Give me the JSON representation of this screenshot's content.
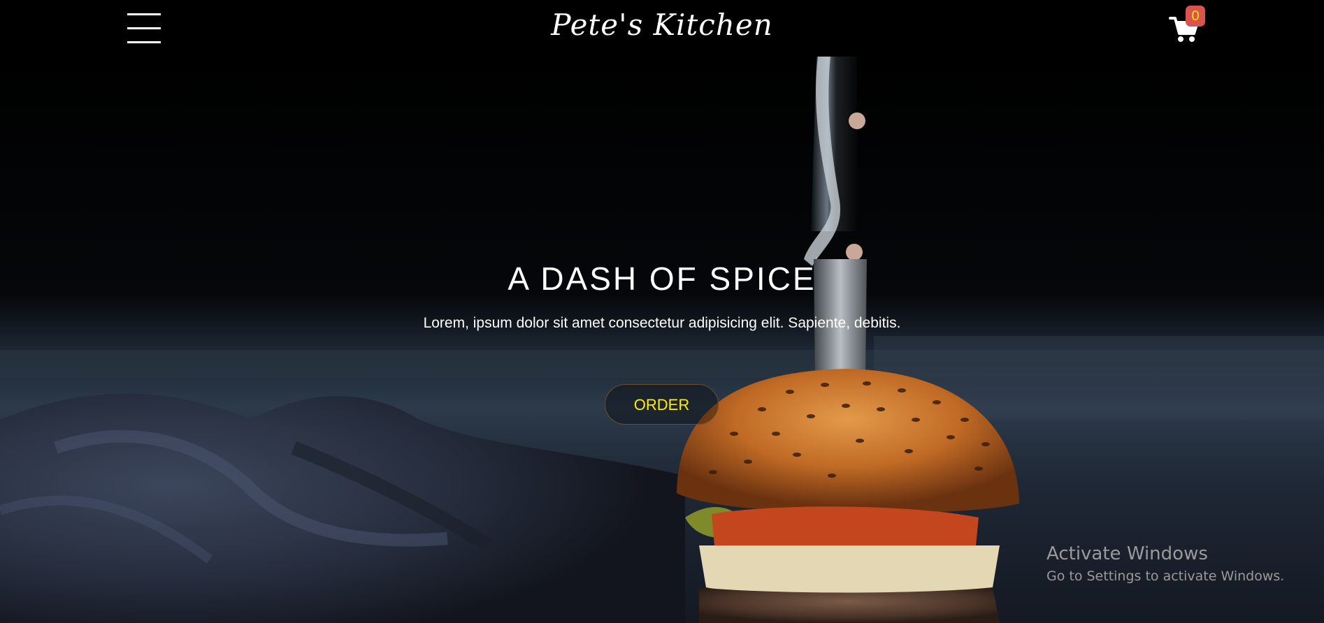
{
  "header": {
    "brand": "Pete's Kitchen",
    "cart_count": "0",
    "menu_icon": "hamburger-menu-icon",
    "cart_icon": "shopping-cart-icon"
  },
  "hero": {
    "title": "A DASH OF SPICE",
    "subtitle": "Lorem, ipsum dolor sit amet consectetur adipisicing elit. Sapiente, debitis.",
    "order_label": "ORDER"
  },
  "watermark": {
    "title": "Activate Windows",
    "subtitle": "Go to Settings to activate Windows."
  },
  "colors": {
    "background": "#000000",
    "text": "#ffffff",
    "accent_yellow": "#ffee00",
    "badge": "#d9534f"
  }
}
